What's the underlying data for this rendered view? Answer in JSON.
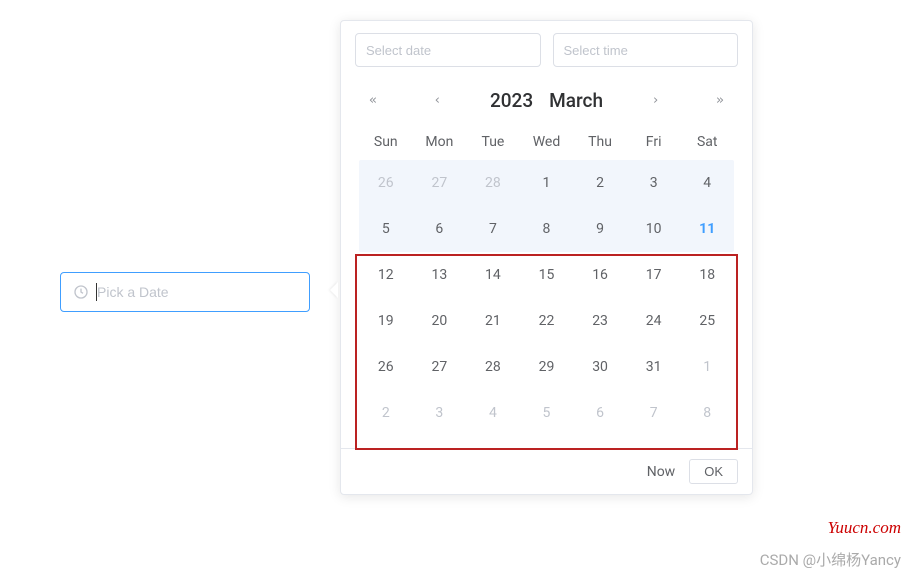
{
  "input": {
    "placeholder": "Pick a Date"
  },
  "popover": {
    "select_date_placeholder": "Select date",
    "select_time_placeholder": "Select time",
    "year": "2023",
    "month": "March",
    "weekdays": [
      "Sun",
      "Mon",
      "Tue",
      "Wed",
      "Thu",
      "Fri",
      "Sat"
    ],
    "days": [
      {
        "n": "26",
        "other": true
      },
      {
        "n": "27",
        "other": true
      },
      {
        "n": "28",
        "other": true
      },
      {
        "n": "1",
        "other": false
      },
      {
        "n": "2",
        "other": false
      },
      {
        "n": "3",
        "other": false
      },
      {
        "n": "4",
        "other": false
      },
      {
        "n": "5",
        "other": false
      },
      {
        "n": "6",
        "other": false
      },
      {
        "n": "7",
        "other": false
      },
      {
        "n": "8",
        "other": false
      },
      {
        "n": "9",
        "other": false
      },
      {
        "n": "10",
        "other": false
      },
      {
        "n": "11",
        "other": false,
        "today": true
      },
      {
        "n": "12",
        "other": false
      },
      {
        "n": "13",
        "other": false
      },
      {
        "n": "14",
        "other": false
      },
      {
        "n": "15",
        "other": false
      },
      {
        "n": "16",
        "other": false
      },
      {
        "n": "17",
        "other": false
      },
      {
        "n": "18",
        "other": false
      },
      {
        "n": "19",
        "other": false
      },
      {
        "n": "20",
        "other": false
      },
      {
        "n": "21",
        "other": false
      },
      {
        "n": "22",
        "other": false
      },
      {
        "n": "23",
        "other": false
      },
      {
        "n": "24",
        "other": false
      },
      {
        "n": "25",
        "other": false
      },
      {
        "n": "26",
        "other": false
      },
      {
        "n": "27",
        "other": false
      },
      {
        "n": "28",
        "other": false
      },
      {
        "n": "29",
        "other": false
      },
      {
        "n": "30",
        "other": false
      },
      {
        "n": "31",
        "other": false
      },
      {
        "n": "1",
        "other": true
      },
      {
        "n": "2",
        "other": true
      },
      {
        "n": "3",
        "other": true
      },
      {
        "n": "4",
        "other": true
      },
      {
        "n": "5",
        "other": true
      },
      {
        "n": "6",
        "other": true
      },
      {
        "n": "7",
        "other": true
      },
      {
        "n": "8",
        "other": true
      }
    ],
    "now_label": "Now",
    "ok_label": "OK"
  },
  "watermarks": {
    "red": "Yuucn.com",
    "grey": "CSDN @小绵杨Yancy"
  }
}
